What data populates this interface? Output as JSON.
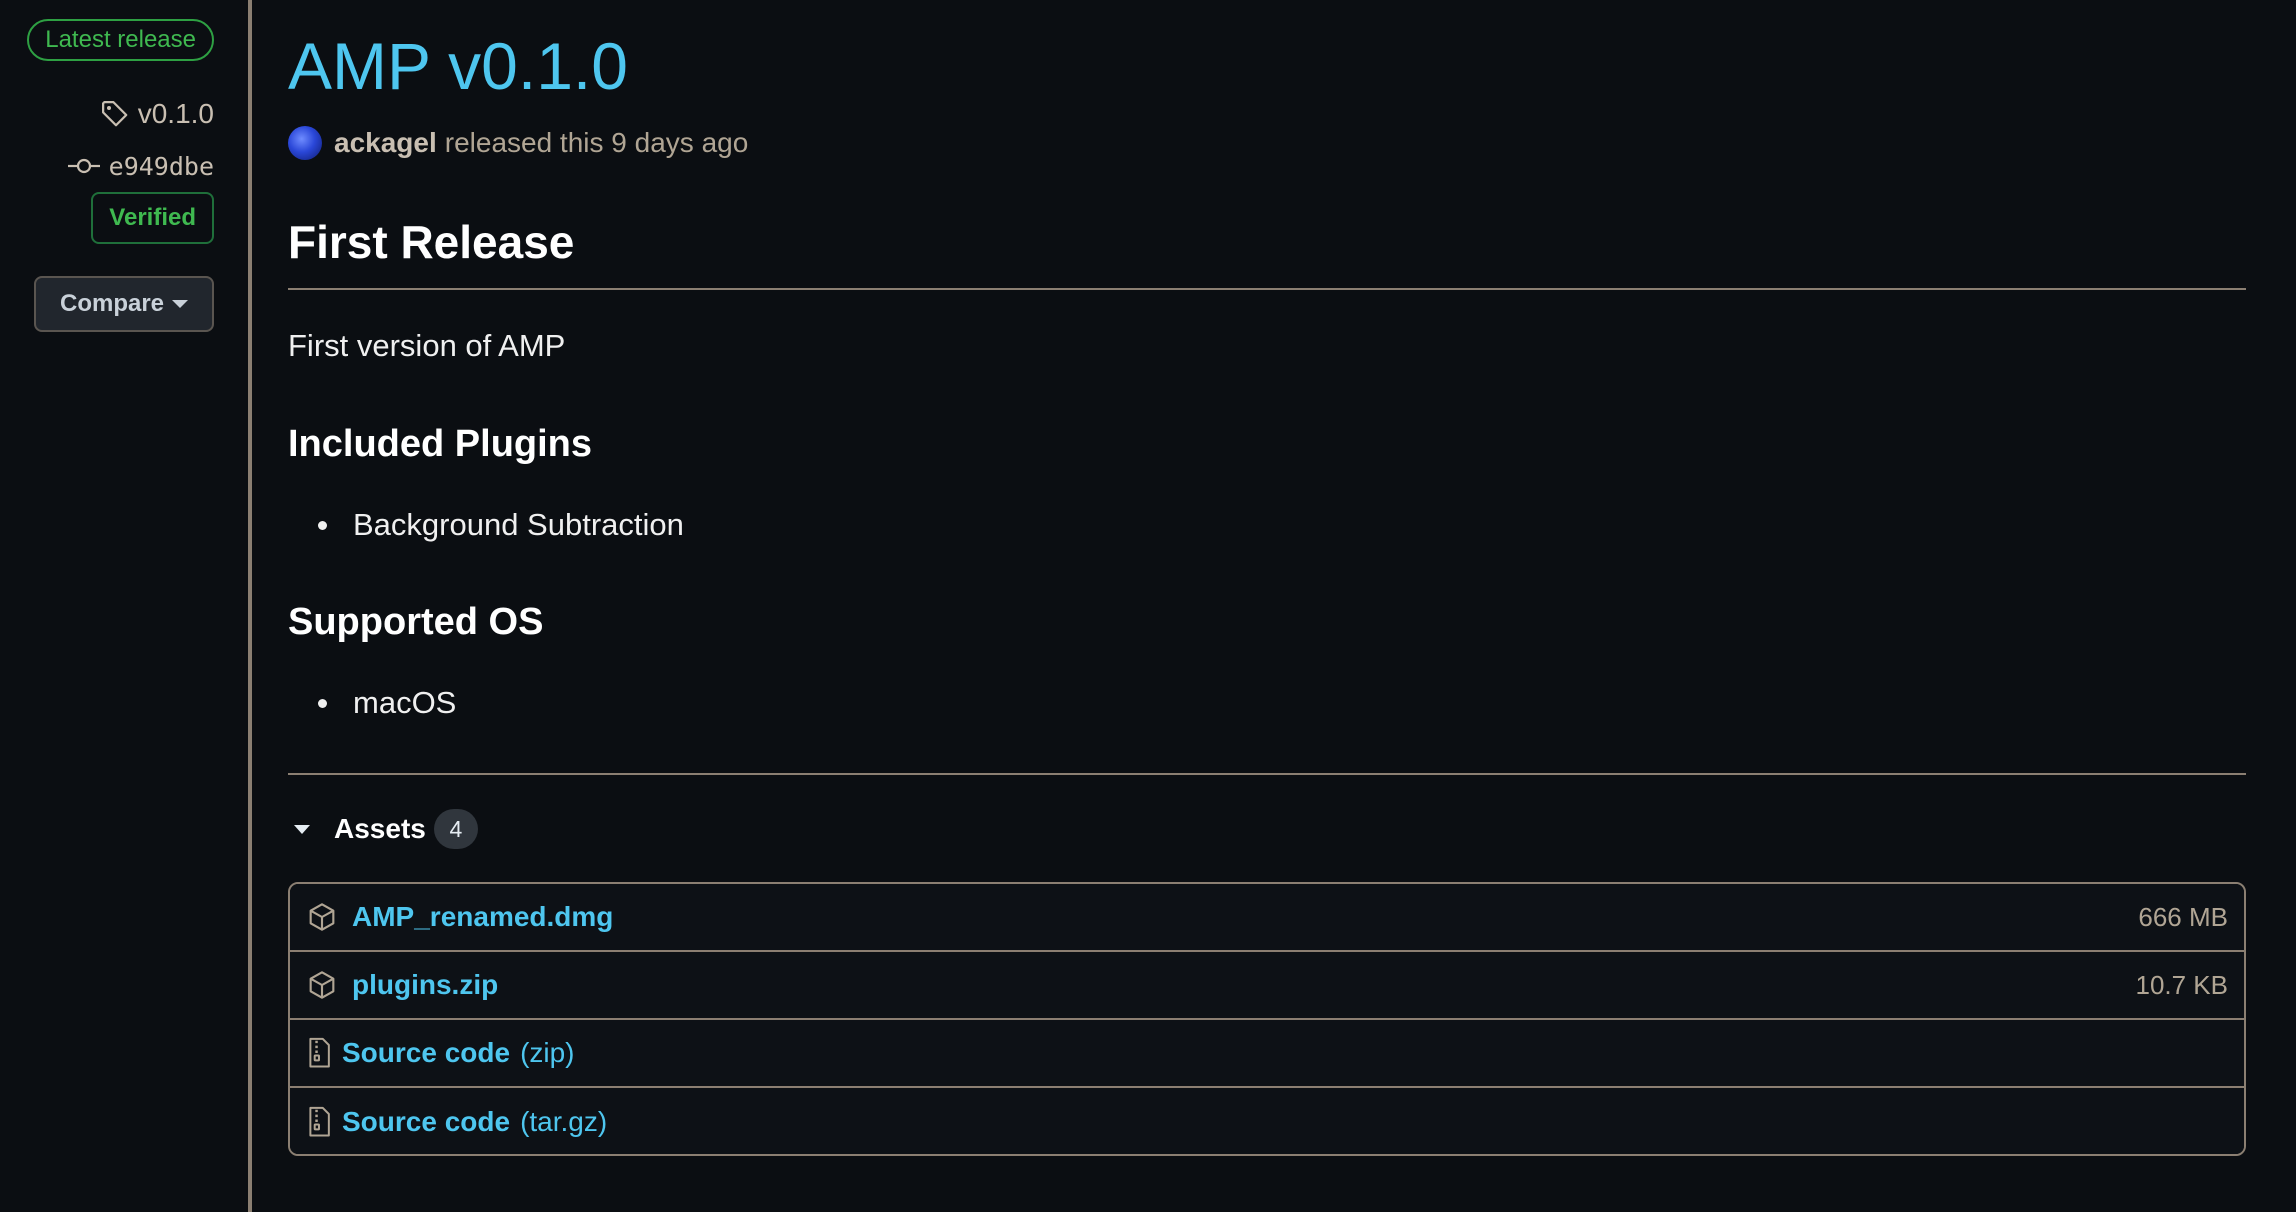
{
  "sidebar": {
    "latest_badge": "Latest release",
    "tag": "v0.1.0",
    "commit": "e949dbe",
    "verified": "Verified",
    "compare_label": "Compare"
  },
  "release": {
    "title": "AMP v0.1.0",
    "author": "ackagel",
    "released_text": "released this 9 days ago"
  },
  "notes": {
    "heading": "First Release",
    "paragraph": "First version of AMP",
    "plugins_heading": "Included Plugins",
    "plugins": [
      "Background Subtraction"
    ],
    "os_heading": "Supported OS",
    "os": [
      "macOS"
    ]
  },
  "assets": {
    "label": "Assets",
    "count": "4",
    "items": [
      {
        "name": "AMP_renamed.dmg",
        "size": "666 MB",
        "icon": "package-icon"
      },
      {
        "name": "plugins.zip",
        "size": "10.7 KB",
        "icon": "package-icon"
      },
      {
        "name": "Source code",
        "suffix": "(zip)",
        "icon": "file-zip-icon"
      },
      {
        "name": "Source code",
        "suffix": "(tar.gz)",
        "icon": "file-zip-icon"
      }
    ]
  },
  "colors": {
    "background": "#0b0e12",
    "link": "#4ec6ef",
    "success": "#3fb950",
    "divider": "#8b7f72",
    "muted": "#b0a594"
  }
}
